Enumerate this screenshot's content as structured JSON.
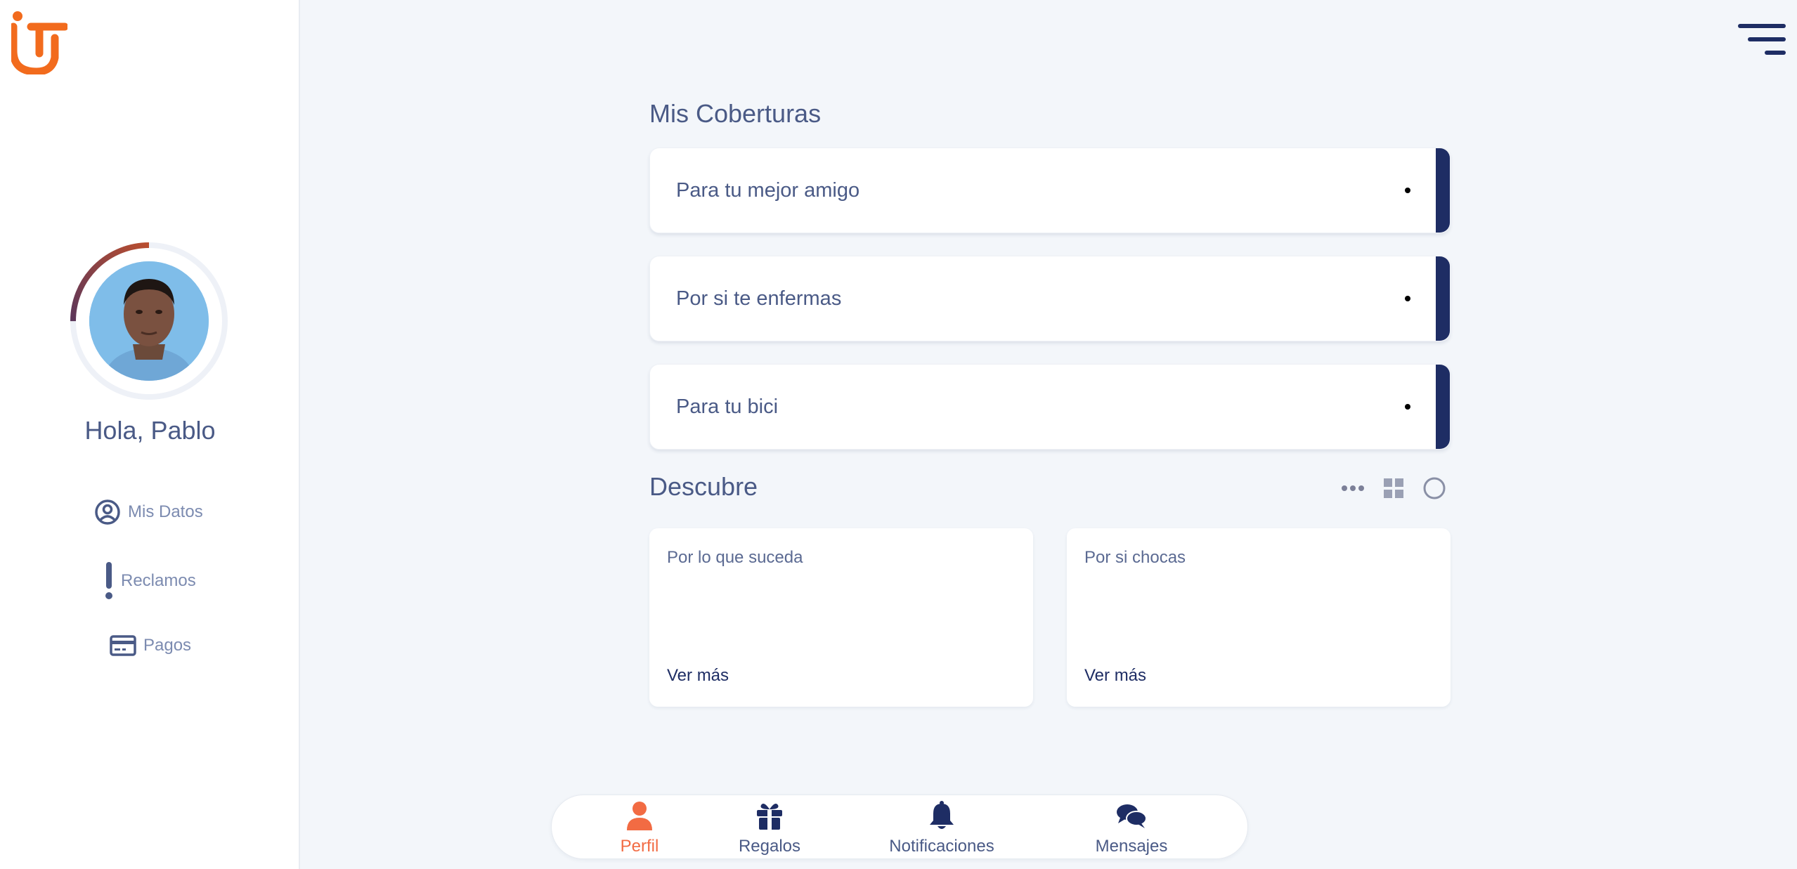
{
  "colors": {
    "brand_orange": "#f26b1d",
    "navy": "#1e2d64",
    "text": "#4a5a86",
    "muted": "#7c8bb0",
    "active": "#f26b43",
    "background": "#f3f6fa"
  },
  "sidebar": {
    "logo_icon": "brand-logo",
    "greeting": "Hola, Pablo",
    "profile_progress": 0.25,
    "items": [
      {
        "label": "Mis Datos",
        "icon": "user-circle-icon"
      },
      {
        "label": "Reclamos",
        "icon": "exclamation-icon"
      },
      {
        "label": "Pagos",
        "icon": "credit-card-icon"
      }
    ]
  },
  "header": {
    "menu_icon": "hamburger-menu-icon"
  },
  "coberturas": {
    "title": "Mis Coberturas",
    "items": [
      {
        "label": "Para tu mejor amigo"
      },
      {
        "label": "Por si te enfermas"
      },
      {
        "label": "Para tu bici"
      }
    ]
  },
  "descubre": {
    "title": "Descubre",
    "view_icons": [
      "more-dots-icon",
      "grid-icon",
      "circle-icon"
    ],
    "cards": [
      {
        "title": "Por lo que suceda",
        "link": "Ver más"
      },
      {
        "title": "Por si chocas",
        "link": "Ver más"
      }
    ]
  },
  "bottom_nav": {
    "items": [
      {
        "label": "Perfil",
        "icon": "person-icon",
        "active": true
      },
      {
        "label": "Regalos",
        "icon": "gift-icon",
        "active": false
      },
      {
        "label": "Notificaciones",
        "icon": "bell-icon",
        "active": false
      },
      {
        "label": "Mensajes",
        "icon": "chat-icon",
        "active": false
      }
    ]
  }
}
